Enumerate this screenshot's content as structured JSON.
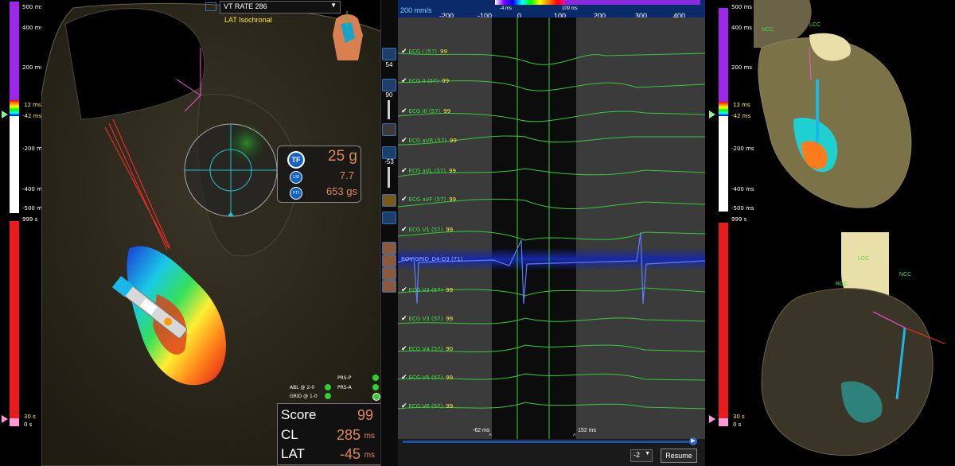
{
  "left_scale": {
    "top_labels": [
      "500 ms",
      "400 ms",
      "200 ms",
      "12 ms",
      "-42 ms",
      "-200 ms",
      "-400 ms",
      "-500 ms"
    ],
    "bottom_labels": [
      "999 s",
      "30 s",
      "0 s"
    ]
  },
  "right_scale": {
    "top_labels": [
      "500 ms",
      "400 ms",
      "200 ms",
      "12 ms",
      "-42 ms",
      "-200 ms",
      "-400 ms",
      "-500 ms"
    ],
    "bottom_labels": [
      "999 s",
      "30 s",
      "0 s"
    ]
  },
  "map_select": {
    "value": "VT RATE 286",
    "subtitle": "LAT Isochronal"
  },
  "force": {
    "tf_badge": "TF",
    "lsi_badge": "LSI",
    "fti_badge": "FTI",
    "force_value": "25 g",
    "lsi_value": "7.7",
    "fti_value": "653 gs"
  },
  "status": {
    "abl": "ABL @ 2-0",
    "grid": "GRID @ 1-0",
    "prs_p": "PRS-P",
    "prs_a": "PRS-A"
  },
  "score_box": {
    "score_label": "Score",
    "score_value": "99",
    "cl_label": "CL",
    "cl_value": "285",
    "cl_unit": "ms",
    "lat_label": "LAT",
    "lat_value": "-45",
    "lat_unit": "ms"
  },
  "toolbar": {
    "val1": "54",
    "val2": "90",
    "val3": "-53"
  },
  "ecg": {
    "speed": "200 mm/s",
    "ticks": [
      "-200",
      "-100",
      "0",
      "100",
      "200",
      "300",
      "400"
    ],
    "window_left": "-4 ms",
    "window_right": "109 ms",
    "channels": [
      {
        "name": "ECG I (57)",
        "value": "99"
      },
      {
        "name": "ECG II (57)",
        "value": "99"
      },
      {
        "name": "ECG III (57)",
        "value": "99"
      },
      {
        "name": "ECG aVR (57)",
        "value": "99"
      },
      {
        "name": "ECG aVL (57)",
        "value": "99"
      },
      {
        "name": "ECG aVF (57)",
        "value": "99"
      },
      {
        "name": "ECG V1 (57)",
        "value": "99"
      },
      {
        "name": "ROV GRID_D4-D3 (71)",
        "value": ""
      },
      {
        "name": "ECG V2 (57)",
        "value": "99"
      },
      {
        "name": "ECG V3 (57)",
        "value": "99"
      },
      {
        "name": "ECG V4 (57)",
        "value": "90"
      },
      {
        "name": "ECG V5 (57)",
        "value": "99"
      },
      {
        "name": "ECG V6 (57)",
        "value": "99"
      }
    ],
    "marker_left": "-62 ms",
    "marker_right": "152 ms",
    "zoom_value": "-2",
    "resume_label": "Resume"
  },
  "anatomy": {
    "ncc_top": "NCC",
    "lcc_top": "LCC",
    "lcc_bottom": "LCC",
    "rcc_bottom": "RCC",
    "ncc_bottom": "NCC"
  }
}
